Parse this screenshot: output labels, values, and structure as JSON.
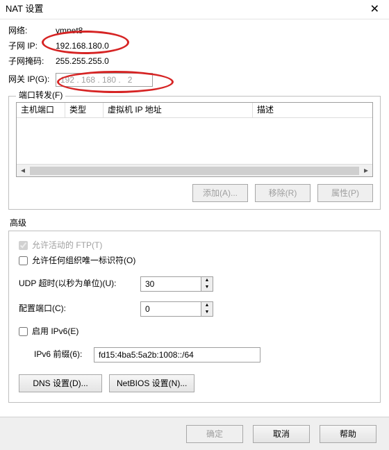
{
  "window": {
    "title": "NAT 设置"
  },
  "network": {
    "label": "网络:",
    "value": "vmnet8",
    "subnet_ip_label": "子网 IP:",
    "subnet_ip": "192.168.180.0",
    "subnet_mask_label": "子网掩码:",
    "subnet_mask": "255.255.255.0",
    "gateway_label": "网关 IP(G):",
    "gateway": "192 . 168 . 180 .   2"
  },
  "port_forward": {
    "group_title": "端口转发(F)",
    "columns": {
      "host_port": "主机端口",
      "type": "类型",
      "vm_ip": "虚拟机 IP 地址",
      "desc": "描述"
    },
    "buttons": {
      "add": "添加(A)...",
      "remove": "移除(R)",
      "props": "属性(P)"
    }
  },
  "advanced": {
    "heading": "高级",
    "allow_active_ftp_label": "允许活动的 FTP(T)",
    "allow_active_ftp_checked": true,
    "allow_any_oid_label": "允许任何组织唯一标识符(O)",
    "allow_any_oid_checked": false,
    "udp_timeout_label": "UDP 超时(以秒为单位)(U):",
    "udp_timeout_value": "30",
    "config_port_label": "配置端口(C):",
    "config_port_value": "0",
    "enable_ipv6_label": "启用 IPv6(E)",
    "enable_ipv6_checked": false,
    "ipv6_prefix_label": "IPv6 前缀(6):",
    "ipv6_prefix_value": "fd15:4ba5:5a2b:1008::/64",
    "dns_button": "DNS 设置(D)...",
    "netbios_button": "NetBIOS 设置(N)..."
  },
  "footer": {
    "ok": "确定",
    "cancel": "取消",
    "help": "帮助"
  }
}
